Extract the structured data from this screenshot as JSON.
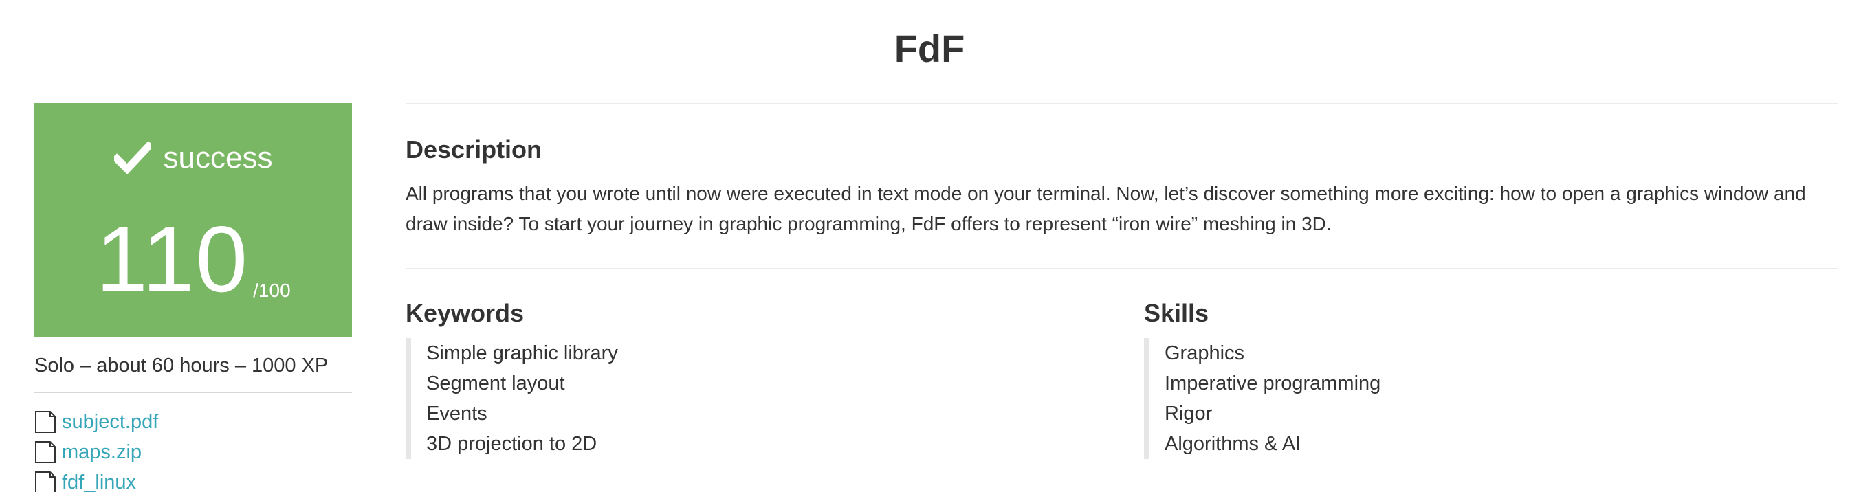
{
  "page": {
    "title": "FdF"
  },
  "sidebar": {
    "status": {
      "label": "success",
      "icon": "check-icon",
      "color": "#7ab764",
      "score": "110",
      "score_max": "/100"
    },
    "meta": "Solo – about 60 hours – 1000 XP",
    "attachments": [
      {
        "name": "subject.pdf",
        "icon": "file-icon"
      },
      {
        "name": "maps.zip",
        "icon": "file-icon"
      },
      {
        "name": "fdf_linux",
        "icon": "file-icon"
      }
    ],
    "link_color": "#35a5b8"
  },
  "main": {
    "description": {
      "title": "Description",
      "text": "All programs that you wrote until now were executed in text mode on your terminal. Now, let’s discover something more exciting: how to open a graphics window and draw inside? To start your journey in graphic programming, FdF offers to represent “iron wire” meshing in 3D."
    },
    "keywords": {
      "title": "Keywords",
      "items": [
        "Simple graphic library",
        "Segment layout",
        "Events",
        "3D projection to 2D"
      ]
    },
    "skills": {
      "title": "Skills",
      "items": [
        "Graphics",
        "Imperative programming",
        "Rigor",
        "Algorithms & AI"
      ]
    }
  }
}
